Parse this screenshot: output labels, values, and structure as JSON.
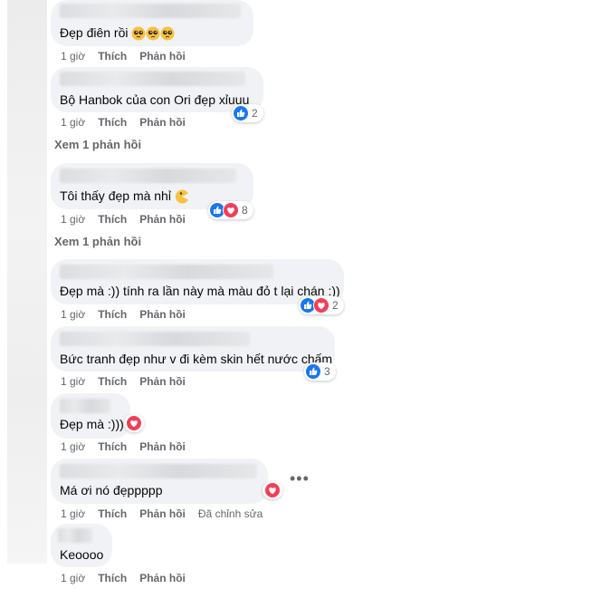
{
  "comments": [
    {
      "text": "Đẹp điên rồi",
      "time": "1 giờ",
      "like": "Thích",
      "reply": "Phản hồi",
      "emojis": [
        "pleading-face-icon",
        "pleading-face-icon",
        "pleading-face-icon"
      ]
    },
    {
      "text": "Bộ Hanbok của con Ori đẹp xỉuuu",
      "time": "1 giờ",
      "like": "Thích",
      "reply": "Phản hồi",
      "reaction_count": "2",
      "reactions": [
        "like-icon"
      ]
    },
    {
      "text": "Tôi thấy đẹp mà nhỉ",
      "time": "1 giờ",
      "like": "Thích",
      "reply": "Phản hồi",
      "reaction_count": "8",
      "reactions": [
        "like-icon",
        "love-icon"
      ]
    },
    {
      "text": "Đẹp mà :)) tính ra lần này mà màu đỏ t lại chán :))",
      "time": "1 giờ",
      "like": "Thích",
      "reply": "Phản hồi",
      "reaction_count": "2",
      "reactions": [
        "like-icon",
        "love-icon"
      ]
    },
    {
      "text": "Bức tranh đẹp như v đi kèm skin hết nước chấm",
      "time": "1 giờ",
      "like": "Thích",
      "reply": "Phản hồi",
      "reaction_count": "3",
      "reactions": [
        "like-icon"
      ]
    },
    {
      "text": "Đẹp mà :)))",
      "time": "1 giờ",
      "like": "Thích",
      "reply": "Phản hồi",
      "reactions": [
        "love-icon"
      ]
    },
    {
      "text": "Má ơi nó đẹppppp",
      "time": "1 giờ",
      "like": "Thích",
      "reply": "Phản hồi",
      "edited": "Đã chỉnh sửa",
      "reactions": [
        "love-icon"
      ]
    },
    {
      "text": "Keoooo",
      "time": "1 giờ",
      "like": "Thích",
      "reply": "Phản hồi"
    }
  ],
  "view_replies": [
    "Xem 1 phản hồi",
    "Xem 1 phản hồi"
  ],
  "more_options": "•••",
  "colors": {
    "bubble": "#f0f2f5",
    "like_blue": "#1877f2",
    "love_red": "#f33e58",
    "muted": "#65676b"
  }
}
